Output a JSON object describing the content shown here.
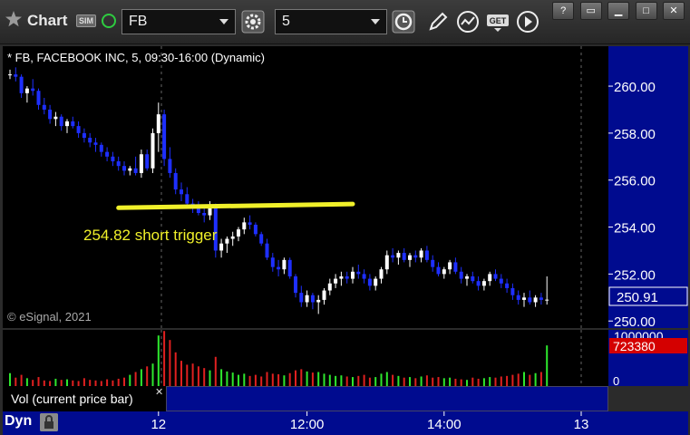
{
  "window": {
    "title": "Chart",
    "sim_badge": "SIM",
    "symbol": "FB",
    "interval": "5",
    "icons": [
      "gear-icon",
      "clock-icon",
      "pencil-icon",
      "line-chart-icon",
      "get-icon",
      "play-icon",
      "minimize-icon",
      "restore-icon",
      "maximize-icon",
      "close-icon"
    ],
    "colors": {
      "accent_blue": "#000b8f",
      "up": "#ffffff",
      "down": "#1e2fff",
      "trend": "#f0f02a"
    }
  },
  "pane": {
    "legend": "* FB, FACEBOOK INC, 5, 09:30-16:00 (Dynamic)",
    "watermark": "© eSignal, 2021",
    "annotation": "254.82 short trigger",
    "last_price": "250.91",
    "vol_legend": "Vol (current price bar)",
    "vol_last": "723380",
    "vol_top_label": "1000000",
    "vol_zero_label": "0",
    "footer": "Dyn"
  },
  "chart_data": {
    "type": "candlestick",
    "y_ticks": [
      "260.00",
      "258.00",
      "256.00",
      "254.00",
      "252.00",
      "250.00"
    ],
    "ylim": [
      249.7,
      261.7
    ],
    "x_ticks": [
      {
        "label": "12",
        "index": 26
      },
      {
        "label": "12:00",
        "index": 52
      },
      {
        "label": "14:00",
        "index": 76
      },
      {
        "label": "13",
        "index": 100
      }
    ],
    "trendline": {
      "from": [
        19,
        254.82
      ],
      "to": [
        60,
        254.98
      ]
    },
    "ohlc": [
      [
        260.5,
        260.7,
        260.3,
        260.5
      ],
      [
        260.5,
        260.8,
        260.2,
        260.4
      ],
      [
        260.4,
        260.5,
        259.5,
        259.7
      ],
      [
        259.7,
        260.0,
        259.3,
        259.9
      ],
      [
        259.9,
        260.3,
        259.6,
        259.8
      ],
      [
        259.8,
        259.9,
        259.0,
        259.2
      ],
      [
        259.2,
        259.5,
        258.8,
        259.0
      ],
      [
        259.0,
        259.2,
        258.4,
        258.6
      ],
      [
        258.6,
        258.9,
        258.3,
        258.7
      ],
      [
        258.7,
        258.8,
        258.1,
        258.3
      ],
      [
        258.3,
        258.6,
        258.0,
        258.5
      ],
      [
        258.5,
        258.7,
        258.2,
        258.3
      ],
      [
        258.3,
        258.5,
        257.8,
        258.0
      ],
      [
        258.0,
        258.2,
        257.6,
        257.8
      ],
      [
        257.8,
        258.0,
        257.4,
        257.6
      ],
      [
        257.6,
        257.8,
        257.2,
        257.5
      ],
      [
        257.5,
        257.6,
        257.0,
        257.2
      ],
      [
        257.2,
        257.4,
        256.8,
        257.0
      ],
      [
        257.0,
        257.2,
        256.6,
        256.8
      ],
      [
        256.8,
        257.0,
        256.4,
        256.6
      ],
      [
        256.6,
        256.8,
        256.2,
        256.4
      ],
      [
        256.4,
        256.6,
        256.2,
        256.5
      ],
      [
        256.5,
        257.0,
        256.2,
        256.3
      ],
      [
        256.3,
        257.3,
        256.1,
        257.1
      ],
      [
        257.1,
        257.3,
        256.4,
        256.5
      ],
      [
        256.5,
        258.2,
        256.3,
        258.0
      ],
      [
        258.0,
        259.3,
        257.2,
        258.8
      ],
      [
        258.8,
        259.0,
        256.6,
        256.9
      ],
      [
        256.9,
        257.4,
        256.1,
        256.3
      ],
      [
        256.3,
        256.5,
        255.4,
        255.6
      ],
      [
        255.6,
        255.9,
        255.1,
        255.4
      ],
      [
        255.4,
        255.7,
        254.8,
        255.0
      ],
      [
        255.0,
        255.2,
        254.6,
        254.8
      ],
      [
        254.8,
        255.1,
        254.5,
        254.6
      ],
      [
        254.6,
        254.8,
        254.2,
        254.5
      ],
      [
        254.5,
        255.1,
        254.3,
        254.8
      ],
      [
        254.8,
        255.0,
        252.7,
        253.0
      ],
      [
        253.0,
        253.5,
        252.7,
        253.3
      ],
      [
        253.3,
        253.6,
        252.9,
        253.5
      ],
      [
        253.5,
        253.8,
        253.2,
        253.6
      ],
      [
        253.6,
        254.0,
        253.4,
        253.9
      ],
      [
        253.9,
        254.4,
        253.7,
        254.2
      ],
      [
        254.2,
        254.5,
        253.9,
        254.1
      ],
      [
        254.1,
        254.2,
        253.6,
        253.7
      ],
      [
        253.7,
        253.8,
        253.2,
        253.3
      ],
      [
        253.3,
        253.5,
        252.6,
        252.7
      ],
      [
        252.7,
        252.9,
        252.1,
        252.3
      ],
      [
        252.3,
        252.6,
        251.9,
        252.2
      ],
      [
        252.2,
        252.7,
        252.0,
        252.6
      ],
      [
        252.6,
        252.7,
        251.8,
        251.9
      ],
      [
        251.9,
        252.0,
        251.0,
        251.2
      ],
      [
        251.2,
        251.5,
        250.6,
        250.8
      ],
      [
        250.8,
        251.3,
        250.6,
        251.1
      ],
      [
        251.1,
        251.2,
        250.5,
        250.8
      ],
      [
        250.8,
        251.1,
        250.3,
        250.9
      ],
      [
        250.9,
        251.4,
        250.7,
        251.3
      ],
      [
        251.3,
        251.8,
        251.1,
        251.6
      ],
      [
        251.6,
        252.0,
        251.4,
        251.8
      ],
      [
        251.8,
        252.1,
        251.5,
        251.9
      ],
      [
        251.9,
        252.1,
        251.6,
        251.8
      ],
      [
        251.8,
        252.3,
        251.6,
        252.1
      ],
      [
        252.1,
        252.4,
        251.8,
        252.0
      ],
      [
        252.0,
        252.2,
        251.6,
        251.8
      ],
      [
        251.8,
        252.0,
        251.3,
        251.5
      ],
      [
        251.5,
        251.9,
        251.3,
        251.8
      ],
      [
        251.8,
        252.3,
        251.6,
        252.2
      ],
      [
        252.2,
        253.0,
        252.0,
        252.8
      ],
      [
        252.8,
        253.1,
        252.5,
        252.7
      ],
      [
        252.7,
        253.0,
        252.4,
        252.9
      ],
      [
        252.9,
        253.1,
        252.5,
        252.6
      ],
      [
        252.6,
        252.9,
        252.3,
        252.8
      ],
      [
        252.8,
        253.0,
        252.5,
        252.7
      ],
      [
        252.7,
        253.1,
        252.5,
        253.0
      ],
      [
        253.0,
        253.2,
        252.5,
        252.6
      ],
      [
        252.6,
        252.8,
        252.1,
        252.3
      ],
      [
        252.3,
        252.5,
        251.9,
        252.0
      ],
      [
        252.0,
        252.3,
        251.8,
        252.2
      ],
      [
        252.2,
        252.6,
        252.0,
        252.5
      ],
      [
        252.5,
        252.7,
        252.0,
        252.1
      ],
      [
        252.1,
        252.3,
        251.6,
        251.8
      ],
      [
        251.8,
        252.0,
        251.5,
        251.9
      ],
      [
        251.9,
        252.1,
        251.6,
        251.7
      ],
      [
        251.7,
        251.9,
        251.3,
        251.5
      ],
      [
        251.5,
        251.8,
        251.3,
        251.7
      ],
      [
        251.7,
        252.1,
        251.5,
        252.0
      ],
      [
        252.0,
        252.2,
        251.7,
        251.8
      ],
      [
        251.8,
        252.0,
        251.4,
        251.6
      ],
      [
        251.6,
        251.8,
        251.2,
        251.4
      ],
      [
        251.4,
        251.6,
        250.9,
        251.1
      ],
      [
        251.1,
        251.3,
        250.7,
        250.9
      ],
      [
        250.9,
        251.2,
        250.6,
        251.0
      ],
      [
        251.0,
        251.3,
        250.7,
        250.8
      ],
      [
        250.8,
        251.1,
        250.6,
        251.0
      ],
      [
        251.0,
        251.2,
        250.7,
        250.9
      ],
      [
        250.9,
        251.9,
        250.7,
        250.91
      ]
    ],
    "volume": [
      230000,
      150000,
      200000,
      140000,
      110000,
      160000,
      100000,
      90000,
      130000,
      110000,
      120000,
      100000,
      90000,
      140000,
      110000,
      100000,
      90000,
      120000,
      100000,
      130000,
      150000,
      200000,
      250000,
      300000,
      350000,
      400000,
      900000,
      980000,
      820000,
      600000,
      450000,
      380000,
      400000,
      350000,
      320000,
      280000,
      520000,
      300000,
      260000,
      240000,
      200000,
      220000,
      180000,
      200000,
      170000,
      250000,
      220000,
      210000,
      190000,
      230000,
      280000,
      300000,
      260000,
      240000,
      250000,
      220000,
      200000,
      180000,
      190000,
      170000,
      160000,
      180000,
      200000,
      150000,
      160000,
      220000,
      250000,
      200000,
      180000,
      150000,
      160000,
      140000,
      170000,
      190000,
      150000,
      160000,
      140000,
      150000,
      130000,
      120000,
      110000,
      150000,
      130000,
      140000,
      160000,
      150000,
      170000,
      180000,
      200000,
      220000,
      250000,
      200000,
      230000,
      250000,
      723380
    ]
  }
}
